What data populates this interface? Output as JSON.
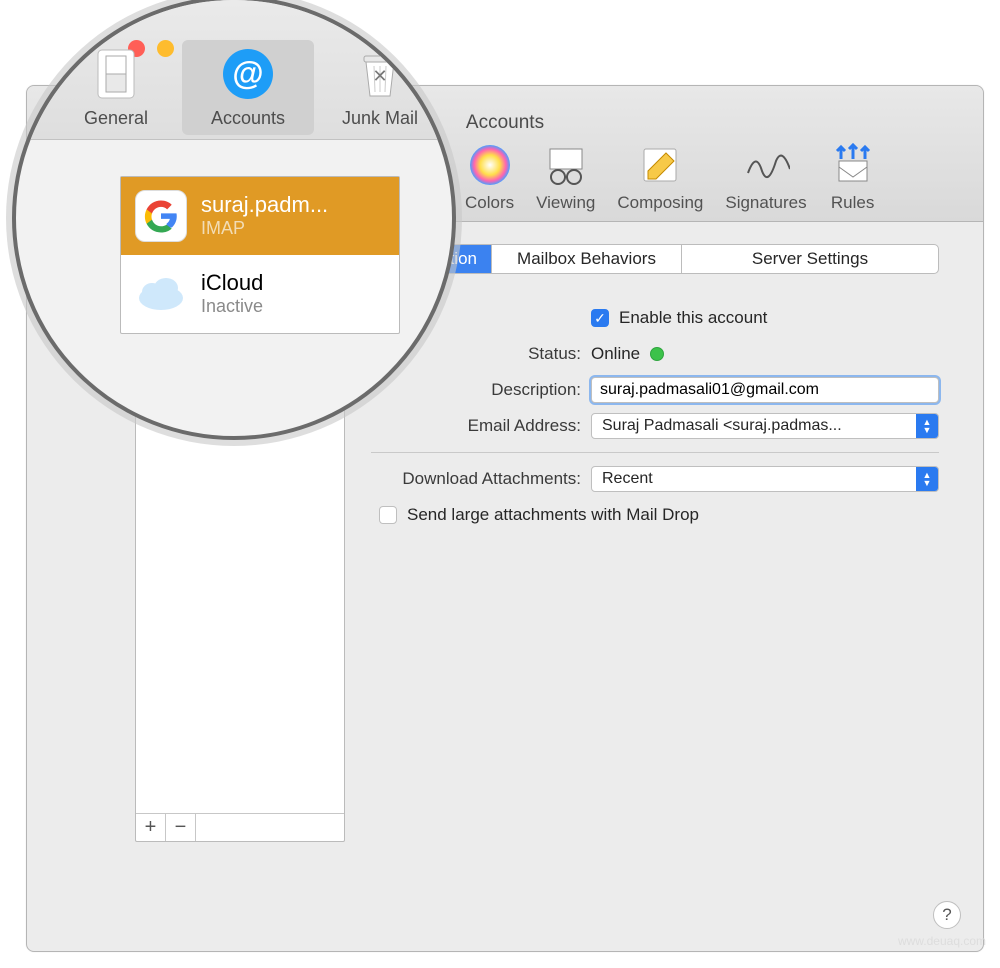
{
  "window_title": "Accounts",
  "toolbar": {
    "general": "General",
    "accounts": "Accounts",
    "junk": "Junk Mail",
    "colors": "Colors",
    "viewing": "Viewing",
    "composing": "Composing",
    "signatures": "Signatures",
    "rules": "Rules"
  },
  "tabs": {
    "info": "t Information",
    "mailbox": "Mailbox Behaviors",
    "server": "Server Settings"
  },
  "form": {
    "enable_label": "Enable this account",
    "status_label": "Status:",
    "status_value": "Online",
    "description_label": "Description:",
    "description_value": "suraj.padmasali01@gmail.com",
    "email_label": "Email Address:",
    "email_value": "Suraj Padmasali <suraj.padmas...",
    "download_label": "Download Attachments:",
    "download_value": "Recent",
    "maildrop_label": "Send large attachments with Mail Drop"
  },
  "sidebar": {
    "add": "+",
    "remove": "−"
  },
  "accounts": [
    {
      "name": "suraj.padm...",
      "proto": "IMAP",
      "provider": "google",
      "selected": true
    },
    {
      "name": "iCloud",
      "proto": "Inactive",
      "provider": "icloud",
      "selected": false
    }
  ],
  "watermark": "www.deuaq.com"
}
